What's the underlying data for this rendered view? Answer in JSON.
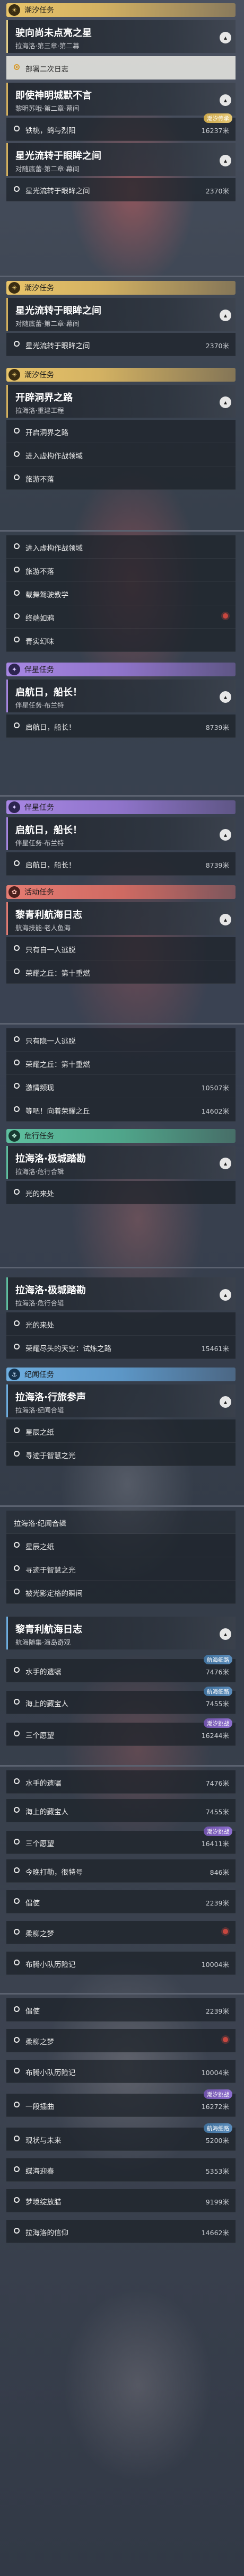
{
  "icons": {
    "gold": "☀",
    "purple": "✦",
    "red": "✿",
    "green": "❖",
    "blue": "⚓",
    "chevron": "▴"
  },
  "rows": {
    "r1": {
      "label": "铁桃，鸽与烈阳",
      "dist": "16237米",
      "tag": "潮汐传承"
    },
    "r2": {
      "label": "星光流转于眼眸之间",
      "dist": "2370米"
    },
    "r3": {
      "label": "星光流转于眼眸之间",
      "dist": "2370米"
    },
    "r4": {
      "label": "启航日，船长！",
      "dist": "8739米"
    },
    "r5": {
      "label": "启航日，船长！",
      "dist": "8739米"
    },
    "r6": {
      "label": "只有隐一人逃脱"
    },
    "r7": {
      "label": "荣耀之丘：第十重燃"
    },
    "r8": {
      "label": "激情频现",
      "dist": "10507米"
    },
    "r9": {
      "label": "等吧！向着荣耀之丘",
      "dist": "14602米"
    },
    "r10": {
      "label": "光的来处"
    },
    "r11": {
      "label": "光的来处"
    },
    "r12": {
      "label": "荣耀尽头的天空：试炼之路",
      "dist": "15461米"
    },
    "r13": {
      "label": "星辰之纸"
    },
    "r14": {
      "label": "寻迹于智慧之光"
    },
    "r15": {
      "label": "星辰之纸"
    },
    "r16": {
      "label": "寻迹于智慧之光"
    },
    "r17": {
      "label": "被光影定格的瞬间"
    },
    "r18": {
      "label": "水手的遗嘱",
      "dist": "7476米",
      "tag": "航海细路"
    },
    "r19": {
      "label": "海上的藏宝人",
      "dist": "7455米",
      "tag": "航海细路"
    },
    "r20": {
      "label": "三个愿望",
      "dist": "16244米",
      "tag": "潮汐挑战"
    },
    "r21": {
      "label": "水手的遗嘱",
      "dist": "7476米"
    },
    "r22": {
      "label": "海上的藏宝人",
      "dist": "7455米"
    },
    "r23": {
      "label": "三个愿望",
      "dist": "16411米",
      "tag": "潮汐挑战"
    },
    "r24": {
      "label": "今晚打勒，很特号",
      "dist": "846米"
    },
    "r25": {
      "label": "倡使",
      "dist": "2239米"
    },
    "r26": {
      "label": "柔柳之梦"
    },
    "r27": {
      "label": "布腾小队历险记",
      "dist": "10004米"
    },
    "r28": {
      "label": "倡使",
      "dist": "2239米"
    },
    "r29": {
      "label": "柔柳之梦"
    },
    "r30": {
      "label": "布腾小队历险记",
      "dist": "10004米"
    },
    "r31": {
      "label": "一段插曲",
      "dist": "16272米",
      "tag": "潮汐挑战"
    },
    "r32": {
      "label": "现状与未来",
      "dist": "5200米",
      "tag": "航海细路"
    },
    "r33": {
      "label": "蝶海迎春",
      "dist": "5353米"
    },
    "r34": {
      "label": "梦境绽放腊",
      "dist": "9199米"
    },
    "r35": {
      "label": "拉海洛的信仰",
      "dist": "14662米"
    }
  },
  "cats": {
    "c1": "潮汐任务",
    "c2": "潮汐任务",
    "c3": "伴星任务",
    "c4": "伴星任务",
    "c5": "活动任务",
    "c6": "危行任务",
    "c7": "纪闻任务"
  },
  "quests": {
    "q1": {
      "title": "驶向尚未点亮之星",
      "sub": "拉海洛·第三章·第二幕"
    },
    "q2": {
      "title": "即使神明城默不言",
      "sub": "黎明苏哦·第二章·幕间"
    },
    "q3": {
      "title": "星光流转于眼眸之间",
      "sub": "对随底蕾·第二章·幕间"
    },
    "q4": {
      "title": "星光流转于眼眸之间",
      "sub": "对随底蕾·第二章·幕间"
    },
    "q5": {
      "title": "开辟洞界之路",
      "sub": "拉海洛·重建工程"
    },
    "q6": {
      "title": "启航日，船长！",
      "sub": "伴星任务·布兰特"
    },
    "q7": {
      "title": "启航日，船长！",
      "sub": "伴星任务·布兰特"
    },
    "q8": {
      "title": "黎青利航海日志",
      "sub": "航海技能·老人鱼海"
    },
    "q9": {
      "title": "拉海洛·极城踏勘",
      "sub": "拉海洛·危行合辑"
    },
    "q10": {
      "title": "拉海洛·极城踏勘",
      "sub": "拉海洛·危行合辑"
    },
    "q11": {
      "title": "拉海洛·行旅参声",
      "sub": "拉海洛·纪闻合辑"
    },
    "q12": {
      "title": "拉海洛·纪闻合辑",
      "sub": ""
    },
    "q13": {
      "title": "黎青利航海日志",
      "sub": "航海随集·海岛奇观"
    }
  },
  "active": {
    "label": "部署二次日志"
  },
  "plain": {
    "p1": "开启洞界之路",
    "p2": "进入虚构作战领域",
    "p3": "旅游不落",
    "p4": "进入虚构作战领域",
    "p5": "旅游不落",
    "p6": "载舞驾驶教学",
    "p7": "终端如鸦",
    "p8": "青实幻味",
    "p9": "只有自一人逃脱",
    "p10": "荣耀之丘：第十重燃"
  }
}
